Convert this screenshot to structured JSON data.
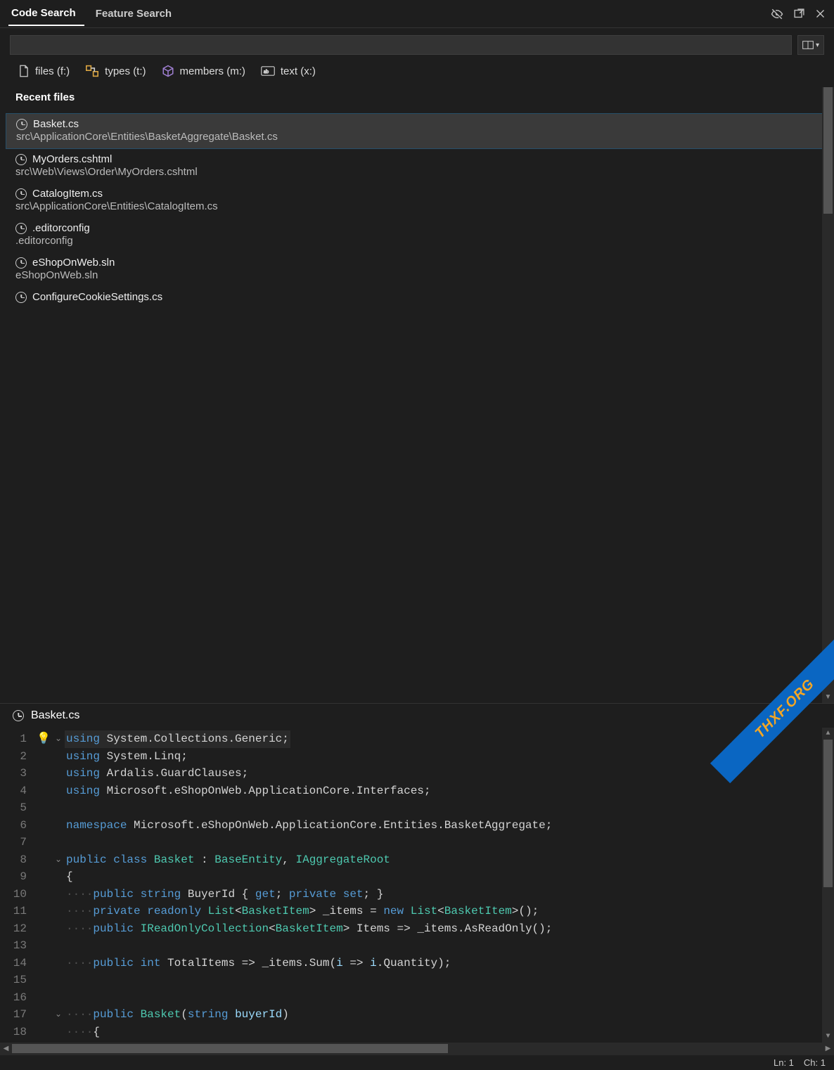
{
  "tabs": {
    "codeSearch": "Code Search",
    "featureSearch": "Feature Search"
  },
  "titlebarIcons": {
    "hide": "hide-icon",
    "open": "open-external-icon",
    "close": "close-icon"
  },
  "scopeDropdown": "▾",
  "filters": {
    "files": "files (f:)",
    "types": "types (t:)",
    "members": "members (m:)",
    "text": "text (x:)"
  },
  "sectionTitle": "Recent files",
  "recentFiles": [
    {
      "name": "Basket.cs",
      "path": "src\\ApplicationCore\\Entities\\BasketAggregate\\Basket.cs",
      "selected": true
    },
    {
      "name": "MyOrders.cshtml",
      "path": "src\\Web\\Views\\Order\\MyOrders.cshtml",
      "selected": false
    },
    {
      "name": "CatalogItem.cs",
      "path": "src\\ApplicationCore\\Entities\\CatalogItem.cs",
      "selected": false
    },
    {
      "name": ".editorconfig",
      "path": ".editorconfig",
      "selected": false
    },
    {
      "name": "eShopOnWeb.sln",
      "path": "eShopOnWeb.sln",
      "selected": false
    },
    {
      "name": "ConfigureCookieSettings.cs",
      "path": "",
      "selected": false
    }
  ],
  "preview": {
    "fileName": "Basket.cs",
    "lines": [
      {
        "n": 1,
        "glyph": "bulb",
        "fold": "v",
        "html": "<span class='sel-line'><span class='kw'>using</span> <span class='ns'>System.Collections.Generic</span>;</span>"
      },
      {
        "n": 2,
        "glyph": "",
        "fold": "",
        "html": "<span class='kw'>using</span> <span class='ns'>System.Linq</span>;"
      },
      {
        "n": 3,
        "glyph": "",
        "fold": "",
        "html": "<span class='kw'>using</span> <span class='ns'>Ardalis.GuardClauses</span>;"
      },
      {
        "n": 4,
        "glyph": "",
        "fold": "",
        "html": "<span class='kw'>using</span> <span class='ns'>Microsoft.eShopOnWeb.ApplicationCore.Interfaces</span>;"
      },
      {
        "n": 5,
        "glyph": "",
        "fold": "",
        "html": ""
      },
      {
        "n": 6,
        "glyph": "",
        "fold": "",
        "html": "<span class='kw'>namespace</span> <span class='ns'>Microsoft.eShopOnWeb.ApplicationCore.Entities.BasketAggregate</span>;"
      },
      {
        "n": 7,
        "glyph": "",
        "fold": "",
        "html": ""
      },
      {
        "n": 8,
        "glyph": "",
        "fold": "v",
        "html": "<span class='kw'>public</span> <span class='kw'>class</span> <span class='type'>Basket</span> : <span class='type'>BaseEntity</span>, <span class='type'>IAggregateRoot</span>"
      },
      {
        "n": 9,
        "glyph": "",
        "fold": "",
        "html": "<span class='punc'>{</span>"
      },
      {
        "n": 10,
        "glyph": "",
        "fold": "",
        "html": "<span class='dim-dots'>····</span><span class='kw'>public</span> <span class='kw'>string</span> <span class='ns'>BuyerId</span> { <span class='kw'>get</span>; <span class='kw'>private</span> <span class='kw'>set</span>; }"
      },
      {
        "n": 11,
        "glyph": "",
        "fold": "",
        "html": "<span class='dim-dots'>····</span><span class='kw'>private</span> <span class='kw'>readonly</span> <span class='type'>List</span>&lt;<span class='type'>BasketItem</span>&gt; <span class='ns'>_items</span> = <span class='kw'>new</span> <span class='type'>List</span>&lt;<span class='type'>BasketItem</span>&gt;();"
      },
      {
        "n": 12,
        "glyph": "",
        "fold": "",
        "html": "<span class='dim-dots'>····</span><span class='kw'>public</span> <span class='type'>IReadOnlyCollection</span>&lt;<span class='type'>BasketItem</span>&gt; <span class='ns'>Items</span> =&gt; <span class='ns'>_items</span>.<span class='ns'>AsReadOnly</span>();"
      },
      {
        "n": 13,
        "glyph": "",
        "fold": "",
        "html": ""
      },
      {
        "n": 14,
        "glyph": "",
        "fold": "",
        "html": "<span class='dim-dots'>····</span><span class='kw'>public</span> <span class='kw'>int</span> <span class='ns'>TotalItems</span> =&gt; <span class='ns'>_items</span>.<span class='ns'>Sum</span>(<span class='id'>i</span> =&gt; <span class='id'>i</span>.<span class='ns'>Quantity</span>);"
      },
      {
        "n": 15,
        "glyph": "",
        "fold": "",
        "html": ""
      },
      {
        "n": 16,
        "glyph": "",
        "fold": "",
        "html": ""
      },
      {
        "n": 17,
        "glyph": "",
        "fold": "v",
        "html": "<span class='dim-dots'>····</span><span class='kw'>public</span> <span class='type'>Basket</span>(<span class='kw'>string</span> <span class='id'>buyerId</span>)"
      },
      {
        "n": 18,
        "glyph": "",
        "fold": "",
        "html": "<span class='dim-dots'>····</span>{"
      }
    ]
  },
  "status": {
    "ln": "Ln: 1",
    "ch": "Ch: 1"
  },
  "watermark": "THXF.ORG"
}
